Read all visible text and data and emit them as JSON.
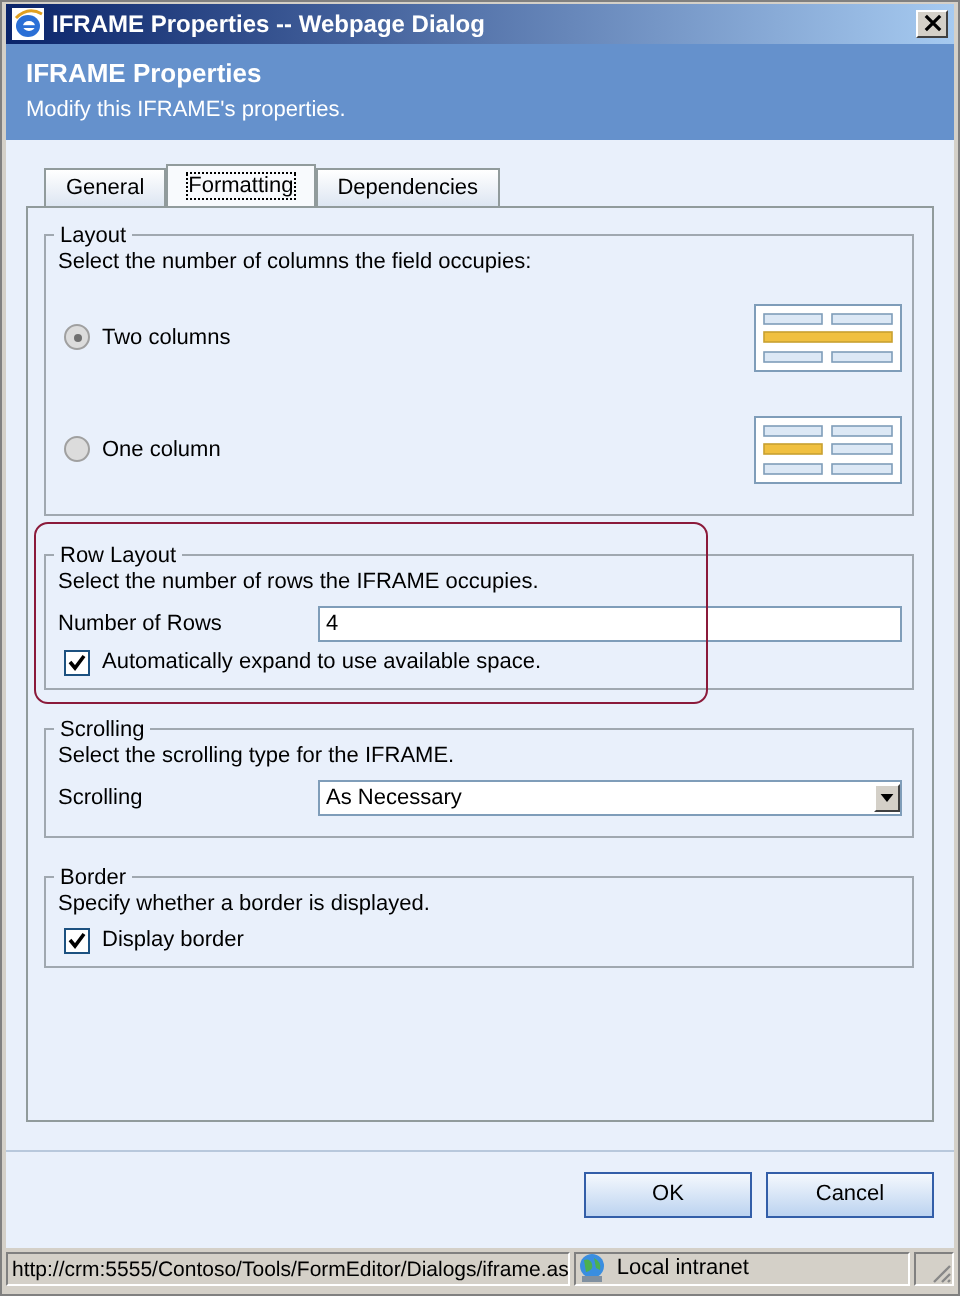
{
  "window": {
    "title": "IFRAME Properties -- Webpage Dialog"
  },
  "header": {
    "title": "IFRAME Properties",
    "subtitle": "Modify this IFRAME's properties."
  },
  "tabs": [
    {
      "label": "General",
      "selected": false
    },
    {
      "label": "Formatting",
      "selected": true
    },
    {
      "label": "Dependencies",
      "selected": false
    }
  ],
  "sections": [
    {
      "kind": "radio",
      "legend": "Layout",
      "highlighted": false,
      "description": "Select the number of columns the field occupies:",
      "options": [
        {
          "label": "Two columns",
          "selected": true,
          "kind": "wide"
        },
        {
          "label": "One column",
          "selected": false,
          "kind": "narrow"
        }
      ]
    },
    {
      "kind": "text",
      "legend": "Row Layout",
      "highlighted": true,
      "description": "Select the number of rows the IFRAME occupies.",
      "field_label": "Number of Rows",
      "value": "4",
      "checkbox": {
        "label": "Automatically expand to use available space.",
        "checked": true
      }
    },
    {
      "kind": "select",
      "legend": "Scrolling",
      "highlighted": false,
      "description": "Select the scrolling type for the IFRAME.",
      "field_label": "Scrolling",
      "value": "As Necessary"
    },
    {
      "kind": "check",
      "legend": "Border",
      "highlighted": false,
      "description": "Specify whether a border is displayed.",
      "checkbox": {
        "label": "Display border",
        "checked": true
      }
    }
  ],
  "buttons": [
    "OK",
    "Cancel"
  ],
  "status_bar": {
    "url": "http://crm:5555/Contoso/Tools/FormEditor/Dialogs/iframe.as",
    "zone": "Local intranet"
  }
}
